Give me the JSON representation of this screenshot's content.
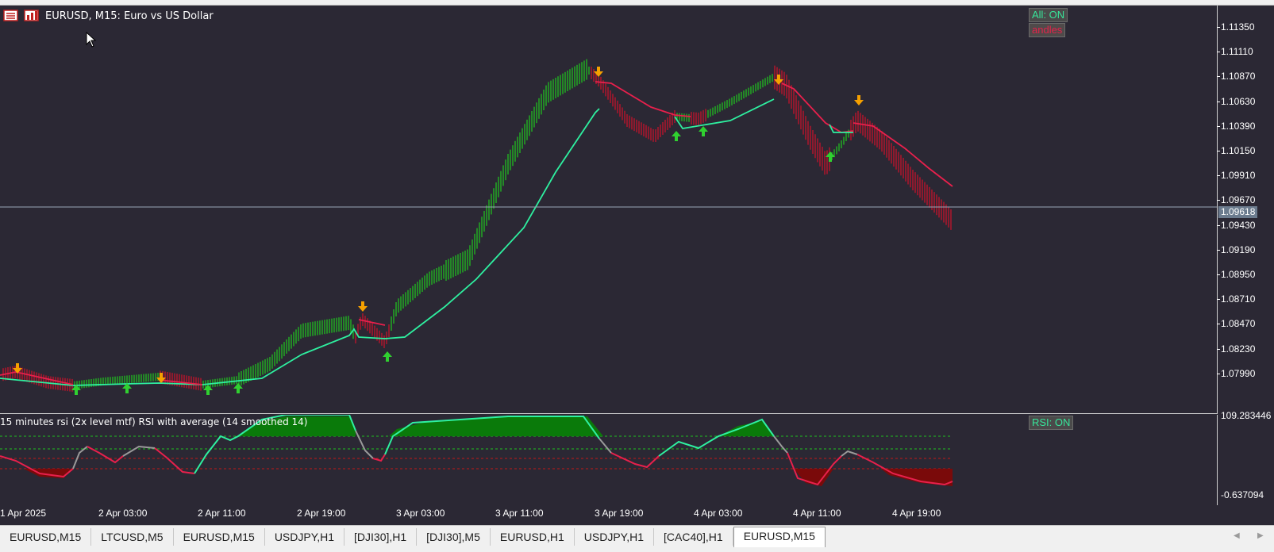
{
  "window": {
    "title": "EURUSD, M15:  Euro vs US Dollar"
  },
  "main_chart": {
    "buttons": {
      "all": "All: ON",
      "andles": "andles"
    },
    "current_price": "1.09618",
    "price_scale": [
      "1.11350",
      "1.11110",
      "1.10870",
      "1.10630",
      "1.10390",
      "1.10150",
      "1.09910",
      "1.09670",
      "1.09430",
      "1.09190",
      "1.08950",
      "1.08710",
      "1.08470",
      "1.08230",
      "1.07990"
    ]
  },
  "indicator": {
    "title": "15 minutes rsi (2x level mtf) RSI with average (14 smoothed 14)",
    "button": "RSI: ON",
    "scale_top": "109.283446",
    "scale_bottom": "-0.637094"
  },
  "time_axis": [
    "1 Apr 2025",
    "2 Apr 03:00",
    "2 Apr 11:00",
    "2 Apr 19:00",
    "3 Apr 03:00",
    "3 Apr 11:00",
    "3 Apr 19:00",
    "4 Apr 03:00",
    "4 Apr 11:00",
    "4 Apr 19:00"
  ],
  "tabs": [
    "EURUSD,M15",
    "LTCUSD,M5",
    "EURUSD,M15",
    "USDJPY,H1",
    "[DJI30],H1",
    "[DJI30],M5",
    "EURUSD,H1",
    "USDJPY,H1",
    "[CAC40],H1",
    "EURUSD,M15"
  ],
  "active_tab_index": 9,
  "colors": {
    "background": "#2b2834",
    "bull": "#1fc81f",
    "bear": "#d0102a",
    "avg_up": "#2ef0a0",
    "avg_down": "#e8204c",
    "arrow_up": "#30d030",
    "arrow_down": "#f5a000"
  },
  "icons": {
    "cursor": "mouse-pointer-icon"
  }
}
